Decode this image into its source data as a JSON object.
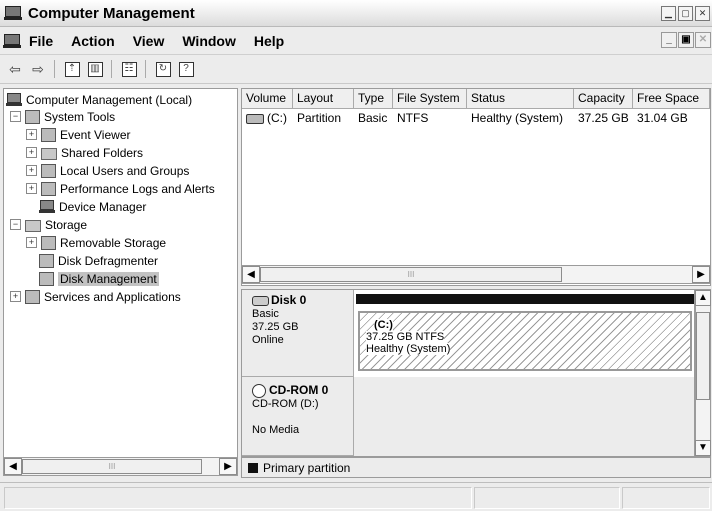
{
  "window": {
    "title": "Computer Management"
  },
  "menu": {
    "items": [
      "File",
      "Action",
      "View",
      "Window",
      "Help"
    ]
  },
  "toolbar": {
    "buttons": [
      "back-arrow",
      "forward-arrow",
      "up-folder",
      "show-hide-tree",
      "properties",
      "refresh",
      "help"
    ]
  },
  "tree": {
    "items": [
      {
        "label": "Computer Management (Local)",
        "icon": "computer-icon"
      },
      {
        "label": "System Tools",
        "icon": "system-tools-icon",
        "expander": "−"
      },
      {
        "label": "Event Viewer",
        "icon": "event-viewer-icon",
        "expander": "+"
      },
      {
        "label": "Shared Folders",
        "icon": "shared-folders-icon",
        "expander": "+"
      },
      {
        "label": "Local Users and Groups",
        "icon": "users-icon",
        "expander": "+"
      },
      {
        "label": "Performance Logs and Alerts",
        "icon": "performance-icon",
        "expander": "+"
      },
      {
        "label": "Device Manager",
        "icon": "device-manager-icon"
      },
      {
        "label": "Storage",
        "icon": "storage-icon",
        "expander": "−"
      },
      {
        "label": "Removable Storage",
        "icon": "removable-storage-icon",
        "expander": "+"
      },
      {
        "label": "Disk Defragmenter",
        "icon": "defragmenter-icon"
      },
      {
        "label": "Disk Management",
        "icon": "disk-management-icon",
        "selected": true
      },
      {
        "label": "Services and Applications",
        "icon": "services-icon",
        "expander": "+"
      }
    ]
  },
  "volumes": {
    "columns": [
      "Volume",
      "Layout",
      "Type",
      "File System",
      "Status",
      "Capacity",
      "Free Space"
    ],
    "rows": [
      {
        "volume": "(C:)",
        "layout": "Partition",
        "type": "Basic",
        "file_system": "NTFS",
        "status": "Healthy (System)",
        "capacity": "37.25 GB",
        "free_space": "31.04 GB"
      }
    ],
    "scroll_thumb_glyph": "III"
  },
  "disks": [
    {
      "name": "Disk 0",
      "type": "Basic",
      "size": "37.25 GB",
      "state": "Online",
      "partition": {
        "name": "(C:)",
        "size_fs": "37.25 GB NTFS",
        "status": "Healthy (System)"
      }
    },
    {
      "name": "CD-ROM 0",
      "drive": "CD-ROM (D:)",
      "media": "No Media"
    }
  ],
  "legend": {
    "label": "Primary partition",
    "color": "#111111"
  },
  "tree_scroll": {
    "thumb_glyph": "III"
  }
}
